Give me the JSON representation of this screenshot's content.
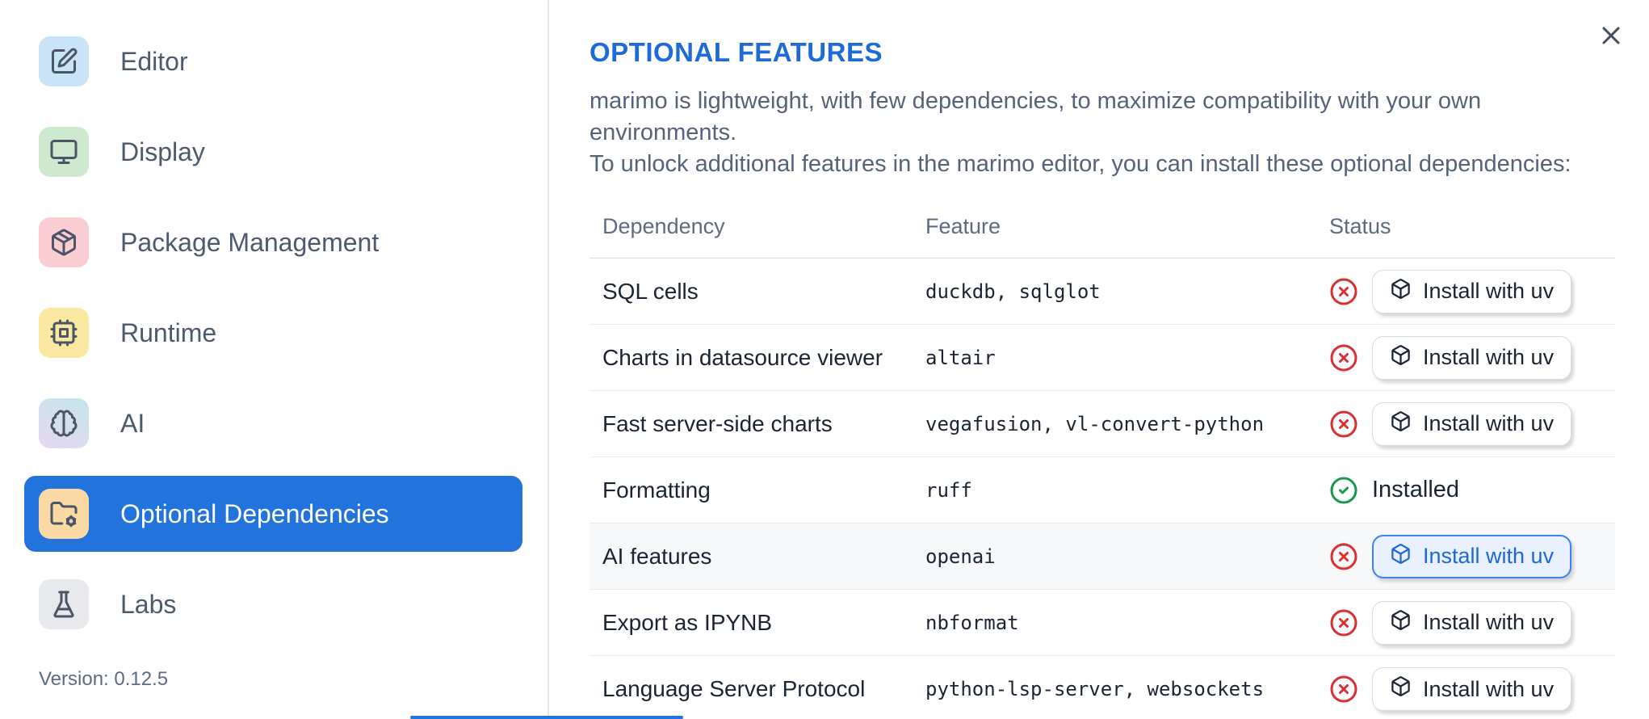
{
  "sidebar": {
    "items": [
      {
        "label": "Editor",
        "icon": "square-pen-icon",
        "tile_color": "#c9e4f8",
        "selected": false
      },
      {
        "label": "Display",
        "icon": "monitor-icon",
        "tile_color": "#cdeace",
        "selected": false
      },
      {
        "label": "Package Management",
        "icon": "package-icon",
        "tile_color": "#f9cdd1",
        "selected": false
      },
      {
        "label": "Runtime",
        "icon": "cpu-icon",
        "tile_color": "#fbe9a2",
        "selected": false
      },
      {
        "label": "AI",
        "icon": "brain-icon",
        "tile_color": "gradient cyan-to-lavender",
        "selected": false
      },
      {
        "label": "Optional Dependencies",
        "icon": "folder-cog-icon",
        "tile_color": "#fbd9a4",
        "selected": true
      },
      {
        "label": "Labs",
        "icon": "flask-icon",
        "tile_color": "#e7e9ec",
        "selected": false
      }
    ],
    "version": "Version: 0.12.5"
  },
  "dialog": {
    "title": "OPTIONAL FEATURES",
    "description_line1": "marimo is lightweight, with few dependencies, to maximize compatibility with your own environments.",
    "description_line2": "To unlock additional features in the marimo editor, you can install these optional dependencies:",
    "close_icon": "x-icon"
  },
  "table": {
    "columns": {
      "dependency": "Dependency",
      "feature": "Feature",
      "status": "Status"
    },
    "rows": [
      {
        "dependency": "SQL cells",
        "feature": "duckdb, sqlglot",
        "installed": false,
        "action": "Install with uv"
      },
      {
        "dependency": "Charts in datasource viewer",
        "feature": "altair",
        "installed": false,
        "action": "Install with uv"
      },
      {
        "dependency": "Fast server-side charts",
        "feature": "vegafusion, vl-convert-python",
        "installed": false,
        "action": "Install with uv"
      },
      {
        "dependency": "Formatting",
        "feature": "ruff",
        "installed": true,
        "status_text": "Installed"
      },
      {
        "dependency": "AI features",
        "feature": "openai",
        "installed": false,
        "action": "Install with uv",
        "highlighted": true
      },
      {
        "dependency": "Export as IPYNB",
        "feature": "nbformat",
        "installed": false,
        "action": "Install with uv"
      },
      {
        "dependency": "Language Server Protocol",
        "feature": "python-lsp-server, websockets",
        "installed": false,
        "action": "Install with uv"
      }
    ]
  },
  "colors": {
    "selected_item_blue": "#2273dc",
    "title_blue": "#1e6bd7",
    "not_installed_red": "#dc2f2f",
    "installed_green": "#179a4b",
    "highlight_button_border": "#3c82f2"
  }
}
